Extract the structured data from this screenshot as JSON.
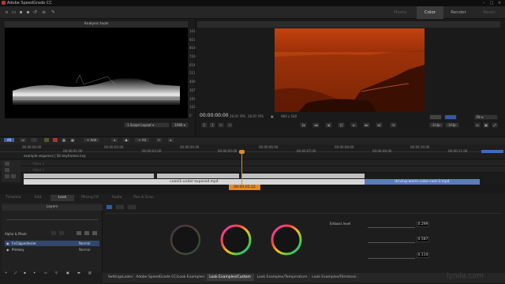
{
  "app": {
    "title": "Adobe SpeedGrade CC",
    "mode_tabs": [
      "Media",
      "Color",
      "Render",
      "Reset"
    ],
    "window_controls": [
      "–",
      "□",
      "×"
    ]
  },
  "scopes": {
    "header": "Analysis tools",
    "scale": [
      "1023",
      "921",
      "818",
      "716",
      "614",
      "511",
      "409",
      "307",
      "205",
      "102",
      "0"
    ],
    "layout_label": "1 Scope Layout",
    "quality_label": "1080"
  },
  "player": {
    "timecode": "00:00:00:00",
    "fps1": "29.97 FPS",
    "fps2": "29.97 FPS",
    "resolution": "960 x 540",
    "zoom": "Fit",
    "view_2up": "2-Up",
    "view_3up": "3-Up"
  },
  "timeline": {
    "tab_all": "All",
    "ruler_labels": [
      "00:00:00:00",
      "00:00:01:00",
      "00:00:02:00",
      "00:00:03:00",
      "00:00:04:00",
      "00:00:05:00",
      "00:00:06:00",
      "00:00:07:00",
      "00:00:08:00",
      "00:00:09:00",
      "00:00:10:00",
      "00:00:11:00"
    ],
    "sequence_name": "example-sequence | SG-keyframes.ircp",
    "track_labels": [
      "Video 2",
      "Video 1"
    ],
    "clip1": "coast1-under-exposed.mp4",
    "clip2": "driving-warm-color-cast-2.mp4",
    "playhead_tc": "00:00:05:12"
  },
  "lower_tabs": [
    "Timeline",
    "Edit",
    "Look",
    "Mixing FX",
    "Audio",
    "Pan & Scan"
  ],
  "layers": {
    "header": "Layers",
    "alpha_mask": "Alpha & Mask:",
    "items": [
      {
        "name": "FxClippedinsire",
        "mode": "Normal"
      },
      {
        "name": "Primary",
        "mode": "Normal"
      }
    ]
  },
  "look": {
    "emboss_label": "Emboss level",
    "values": [
      "0.299",
      "0.587",
      "0.114"
    ]
  },
  "bottom_tabs": [
    "SettingsLooks",
    "Adobe SpeedGrade CC/Look Examples",
    "Look Examples/Custom",
    "Look Examples/Temperature",
    "Look Examples/Filmstock"
  ],
  "watermark": "lynda.com"
}
